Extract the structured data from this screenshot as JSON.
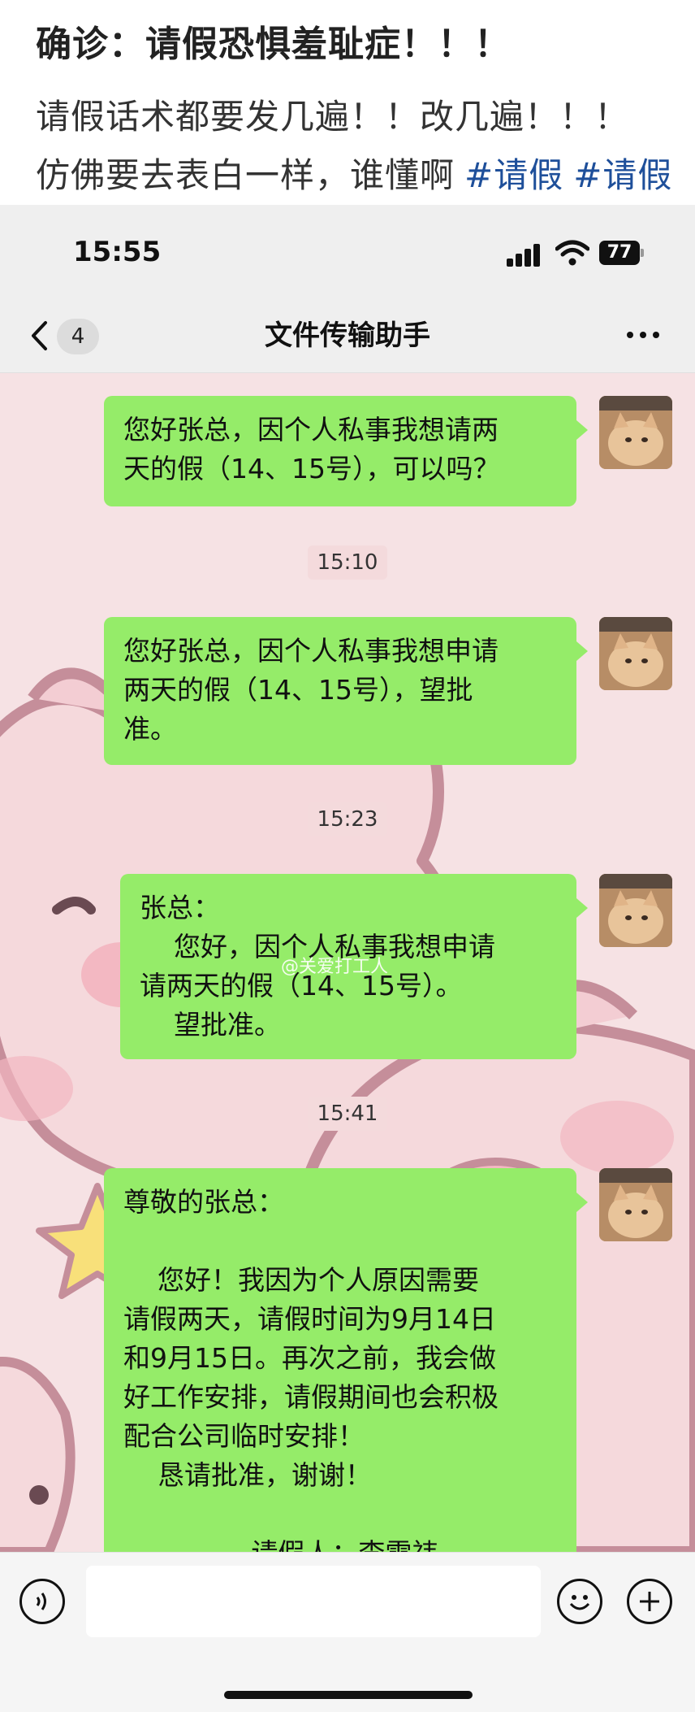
{
  "post": {
    "title": "确诊：请假恐惧羞耻症！！！",
    "line1": "请假话术都要发几遍！！改几遍！！！",
    "line2_text": "仿佛要去表白一样，谁懂啊",
    "hashtags": [
      "#请假",
      "#请假"
    ]
  },
  "status_bar": {
    "time": "15:55",
    "battery": "77"
  },
  "nav": {
    "unread_count": "4",
    "title": "文件传输助手"
  },
  "messages": [
    {
      "text": "您好张总，因个人私事我想请两\n天的假（14、15号），可以吗？"
    },
    {
      "timestamp": "15:10",
      "text": "您好张总，因个人私事我想申请\n两天的假（14、15号），望批\n准。"
    },
    {
      "timestamp": "15:23",
      "text": "张总：\n    您好，因个人私事我想申请\n请两天的假（14、15号）。\n    望批准。"
    },
    {
      "timestamp": "15:41",
      "text": "尊敬的张总：\n\n    您好！我因为个人原因需要\n请假两天，请假时间为9月14日\n和9月15日。再次之前，我会做\n好工作安排，请假期间也会积极\n配合公司临时安排！\n    恳请批准，谢谢！\n\n               请假人：李雪祎"
    }
  ],
  "watermark": "@关爱打工人"
}
